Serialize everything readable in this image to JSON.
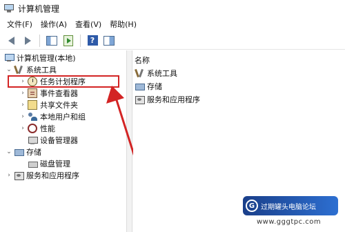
{
  "window": {
    "title": "计算机管理"
  },
  "menu": [
    "文件(F)",
    "操作(A)",
    "查看(V)",
    "帮助(H)"
  ],
  "toolbar": {
    "back": "back-arrow-icon",
    "forward": "forward-arrow-icon",
    "show_hide": "console-tree-icon",
    "export": "export-list-icon",
    "help": "help-icon",
    "properties": "properties-pane-icon"
  },
  "tree": {
    "root": "计算机管理(本地)",
    "system_tools": "系统工具",
    "task_scheduler": "任务计划程序",
    "event_viewer": "事件查看器",
    "shared_folders": "共享文件夹",
    "local_users": "本地用户和组",
    "performance": "性能",
    "device_manager": "设备管理器",
    "storage": "存储",
    "disk_management": "磁盘管理",
    "services": "服务和应用程序"
  },
  "content": {
    "column_header": "名称",
    "items": [
      "系统工具",
      "存储",
      "服务和应用程序"
    ]
  },
  "annotation": {
    "color": "#d32424"
  },
  "watermark": {
    "text": "过期罐头电脑论坛",
    "url": "www.gggtpc.com"
  }
}
